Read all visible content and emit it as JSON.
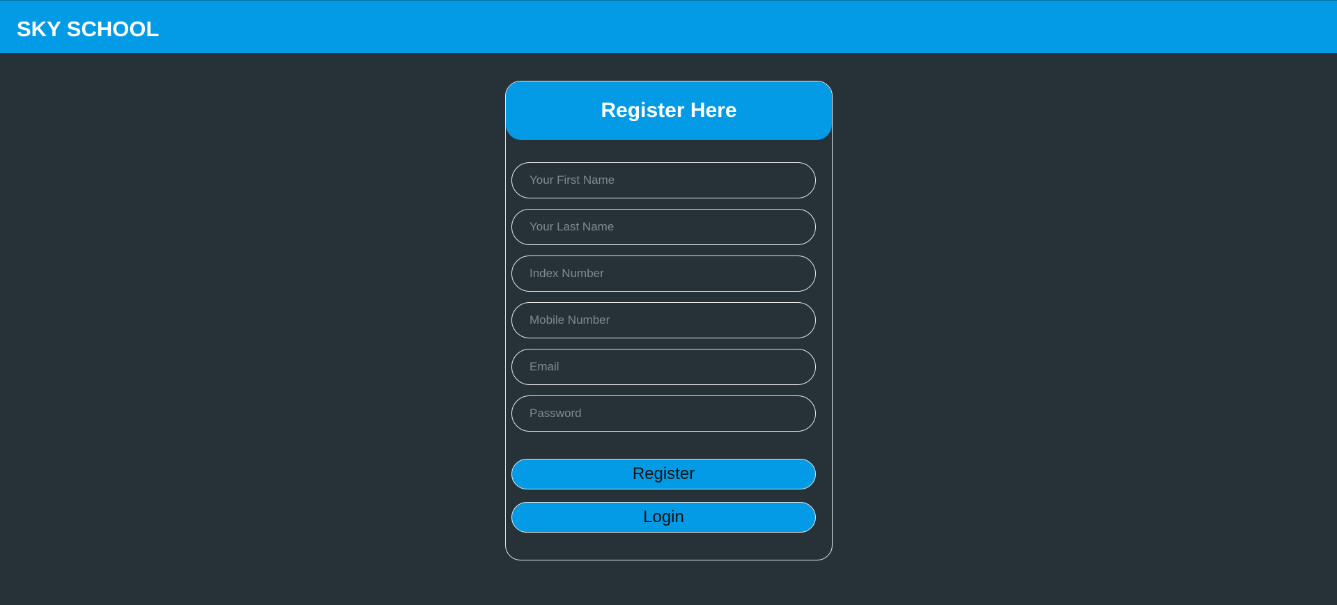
{
  "header": {
    "brand": "SKY SCHOOL"
  },
  "form": {
    "title": "Register Here",
    "fields": [
      {
        "placeholder": "Your First Name",
        "value": ""
      },
      {
        "placeholder": "Your Last Name",
        "value": ""
      },
      {
        "placeholder": "Index Number",
        "value": ""
      },
      {
        "placeholder": "Mobile Number",
        "value": ""
      },
      {
        "placeholder": "Email",
        "value": ""
      },
      {
        "placeholder": "Password",
        "value": ""
      }
    ],
    "register_label": "Register",
    "login_label": "Login"
  },
  "colors": {
    "accent": "#039be5",
    "background": "#263238",
    "border": "#e8e8e8"
  }
}
